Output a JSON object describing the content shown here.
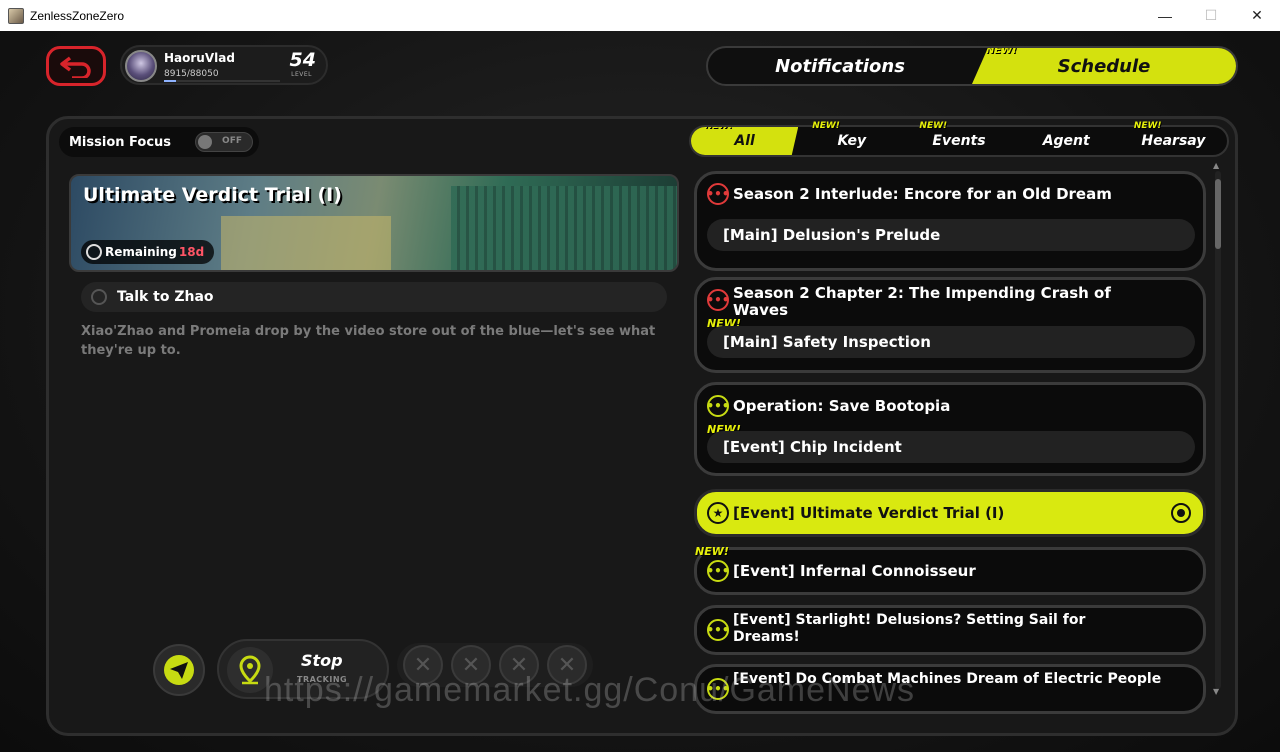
{
  "window": {
    "title": "ZenlessZoneZero",
    "minimize": "—",
    "maximize": "☐",
    "close": "✕"
  },
  "profile": {
    "name": "HaoruVlad",
    "exp": "8915/88050",
    "exp_fraction": 0.101,
    "level": "54",
    "level_label": "LEVEL"
  },
  "top_tabs": [
    {
      "label": "Notifications",
      "new": ""
    },
    {
      "label": "Schedule",
      "new": "NEW!"
    }
  ],
  "mission_focus": {
    "label": "Mission Focus",
    "toggle": "OFF"
  },
  "filters": [
    {
      "label": "All",
      "new": "NEW!"
    },
    {
      "label": "Key",
      "new": "NEW!"
    },
    {
      "label": "Events",
      "new": "NEW!"
    },
    {
      "label": "Agent",
      "new": ""
    },
    {
      "label": "Hearsay",
      "new": "NEW!"
    }
  ],
  "detail": {
    "title": "Ultimate Verdict Trial (I)",
    "remaining_label": "Remaining",
    "remaining_value": "18d",
    "objective": "Talk to Zhao",
    "description": "Xiao'Zhao and Promeia drop by the video store out of the blue—let's see what they're up to."
  },
  "tracking": {
    "stop": "Stop",
    "tracking": "TRACKING"
  },
  "quests": [
    {
      "title": "Season 2 Interlude: Encore for an Old Dream",
      "sub": "[Main] Delusion's Prelude",
      "new": "",
      "icon_color": "red"
    },
    {
      "title": "Season 2 Chapter 2: The Impending Crash of Waves",
      "sub": "[Main] Safety Inspection",
      "new": "NEW!",
      "icon_color": "red"
    },
    {
      "title": "Operation: Save Bootopia",
      "sub": "[Event] Chip Incident",
      "new": "NEW!",
      "icon_color": "green"
    },
    {
      "title": "[Event] Ultimate Verdict Trial (I)",
      "sub": "",
      "new": "",
      "icon_color": "black"
    },
    {
      "title": "[Event] Infernal Connoisseur",
      "sub": "",
      "new": "NEW!",
      "icon_color": "green"
    },
    {
      "title": "[Event] Starlight! Delusions? Setting Sail for Dreams!",
      "sub": "",
      "new": "",
      "icon_color": "green"
    },
    {
      "title": "[Event] Do Combat Machines Dream of Electric People",
      "sub": "",
      "new": "",
      "icon_color": "green"
    }
  ],
  "watermark": "https://gamemarket.gg/Conu/GameNews",
  "colors": {
    "accent": "#d4e10e",
    "danger": "#e03a3a",
    "back": "#d8242b"
  }
}
